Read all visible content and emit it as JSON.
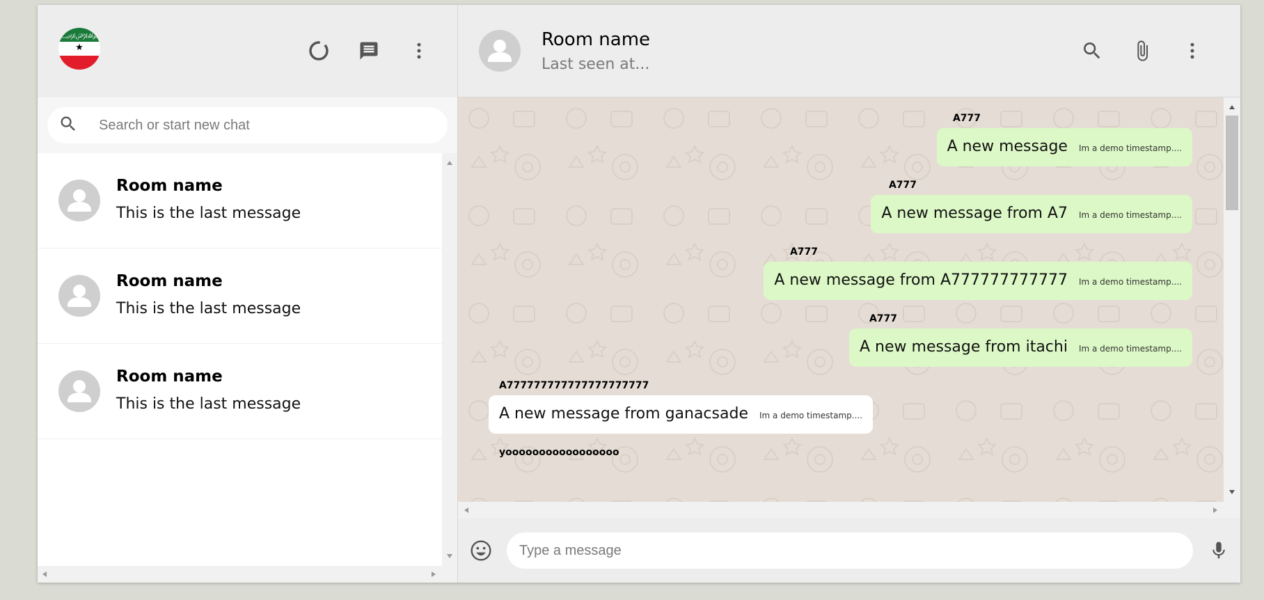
{
  "sidebar": {
    "header": {
      "avatar_icon": "flag-avatar-icon",
      "icons": [
        "status-icon",
        "new-chat-icon",
        "menu-icon"
      ]
    },
    "search": {
      "placeholder": "Search or start new chat"
    },
    "chats": [
      {
        "name": "Room name",
        "last_message": "This is the last message"
      },
      {
        "name": "Room name",
        "last_message": "This is the last message"
      },
      {
        "name": "Room name",
        "last_message": "This is the last message"
      }
    ]
  },
  "chat": {
    "header": {
      "name": "Room name",
      "last_seen": "Last seen at..."
    },
    "icons": [
      "search-icon",
      "attach-icon",
      "menu-icon"
    ],
    "messages": [
      {
        "sender": "A777",
        "text": "A new message",
        "timestamp": "Im a demo timestamp....",
        "mine": true
      },
      {
        "sender": "A777",
        "text": "A new message from A7",
        "timestamp": "Im a demo timestamp....",
        "mine": true
      },
      {
        "sender": "A777",
        "text": "A new message from A777777777777",
        "timestamp": "Im a demo timestamp....",
        "mine": true
      },
      {
        "sender": "A777",
        "text": "A new message from itachi",
        "timestamp": "Im a demo timestamp....",
        "mine": true
      },
      {
        "sender": "A777777777777777777777",
        "text": "A new message from ganacsade",
        "timestamp": "Im a demo timestamp....",
        "mine": false
      },
      {
        "sender": "yooooooooooooooooo",
        "text": "",
        "timestamp": "",
        "mine": false
      }
    ],
    "footer": {
      "placeholder": "Type a message"
    }
  },
  "colors": {
    "background": "#dadbd3",
    "panel": "#ededed",
    "sent_bubble": "#dcf8c6",
    "received_bubble": "#ffffff",
    "chat_bg": "#e5ddd5"
  }
}
